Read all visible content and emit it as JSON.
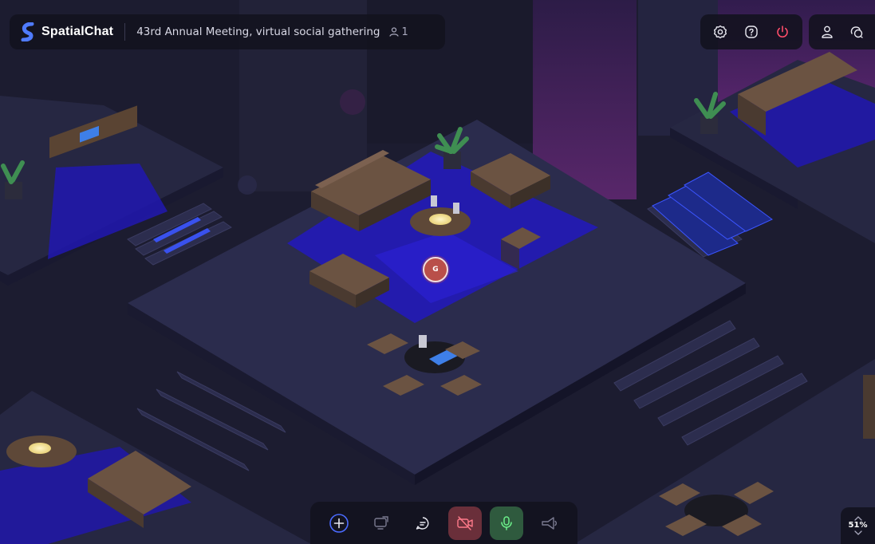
{
  "app": {
    "name": "SpatialChat"
  },
  "room": {
    "title": "43rd Annual Meeting, virtual social gathering",
    "participant_count": "1"
  },
  "avatar": {
    "initial": "G",
    "color": "#b94f4a"
  },
  "zoom": {
    "level": "51%"
  },
  "icons": {
    "logo": "spatialchat-logo-icon",
    "participants": "person-icon",
    "settings": "gear-icon",
    "help": "question-icon",
    "leave": "power-icon",
    "profile": "user-icon",
    "chat": "chat-bubbles-icon",
    "add": "plus-circle-icon",
    "share_screen": "screen-share-icon",
    "message": "message-icon",
    "camera": "camera-off-icon",
    "mic": "microphone-icon",
    "broadcast": "megaphone-icon"
  },
  "colors": {
    "accent": "#4b6bff",
    "logo": "#4f7bff",
    "leave": "#ff4d6a",
    "camera_off_bg": "#6a2f3a",
    "mic_on_bg": "#2f5a3e",
    "floor_glow": "#2b1ed6"
  }
}
